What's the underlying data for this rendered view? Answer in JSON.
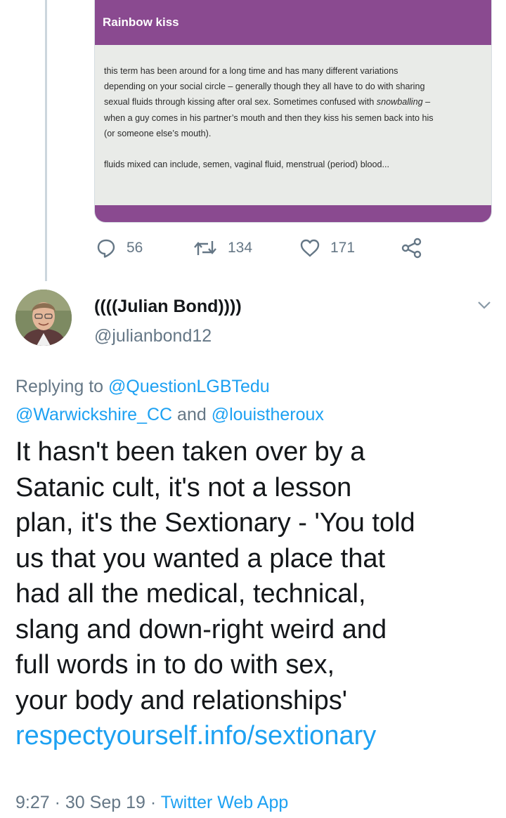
{
  "card": {
    "title": "Rainbow kiss",
    "para1": [
      "this term has been around for a long time and has many different variations",
      "depending on your social circle – generally though they all have to do with sharing",
      "sexual fluids through kissing after oral sex. Sometimes confused with snowballing –",
      "when a guy comes in his partner’s mouth and then they kiss his semen back into his",
      "(or someone else’s mouth)."
    ],
    "para2": "fluids mixed can include, semen, vaginal fluid, menstrual (period) blood...",
    "accent_color": "#8a4a90"
  },
  "actions": {
    "replies": "56",
    "retweets": "134",
    "likes": "171"
  },
  "author": {
    "name": "((((Julian Bond))))",
    "handle": "@julianbond12"
  },
  "reply": {
    "prefix": "Replying to",
    "to1": "@QuestionLGBTedu",
    "to2": "@Warwickshire_CC",
    "and": "and",
    "to3": "@louistheroux"
  },
  "tweet": {
    "lines": [
      "It hasn't been taken over by a",
      "Satanic cult, it's not a lesson",
      "plan, it's the Sextionary - 'You told",
      "us that you wanted a place that",
      "had all the medical, technical,",
      "slang and down-right weird and",
      "full words in to do with sex,",
      "your body and relationships'"
    ],
    "link": "respectyourself.info/sextionary"
  },
  "meta": {
    "time": "9:27",
    "sep1": "·",
    "date": "30 Sep 19",
    "sep2": "·",
    "source": "Twitter Web App"
  }
}
